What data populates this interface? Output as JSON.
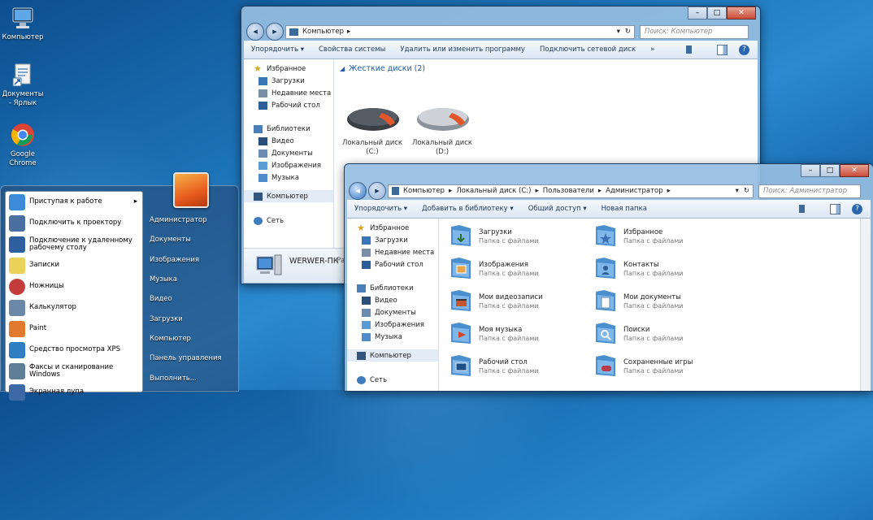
{
  "desktop_icons": [
    {
      "label": "Компьютер"
    },
    {
      "label": "Документы - Ярлык"
    },
    {
      "label": "Google Chrome"
    }
  ],
  "start_menu": {
    "left_items": [
      {
        "label": "Приступая к работе",
        "arrow": "▸",
        "color": "#3c8bd9"
      },
      {
        "label": "Подключить к проектору",
        "color": "#4a6fa0"
      },
      {
        "label": "Подключение к удаленному рабочему столу",
        "color": "#2e5e9e"
      },
      {
        "label": "Записки",
        "color": "#e9d15a"
      },
      {
        "label": "Ножницы",
        "color": "#c23c3c"
      },
      {
        "label": "Калькулятор",
        "color": "#6b88a8"
      },
      {
        "label": "Paint",
        "color": "#e07a2e"
      },
      {
        "label": "Средство просмотра XPS",
        "color": "#2f7ec4"
      },
      {
        "label": "Факсы и сканирование Windows",
        "color": "#5f7f99"
      },
      {
        "label": "Экранная лупа",
        "color": "#3d6aa7"
      }
    ],
    "right_items": [
      {
        "label": "Администратор"
      },
      {
        "label": "Документы"
      },
      {
        "label": "Изображения"
      },
      {
        "label": "Музыка"
      },
      {
        "label": "Видео"
      },
      {
        "label": "Загрузки"
      },
      {
        "label": "Компьютер"
      },
      {
        "label": "Панель управления"
      },
      {
        "label": "Выполнить..."
      }
    ]
  },
  "window1": {
    "caption_buttons": {
      "minimize": "–",
      "maximize": "□",
      "close": "✕"
    },
    "address": {
      "crumb": "Компьютер",
      "sep": "▸",
      "dropdown": "▾",
      "refresh": "↻"
    },
    "search_placeholder": "Поиск: Компьютер",
    "toolbar": {
      "organize": "Упорядочить ▾",
      "system_properties": "Свойства системы",
      "uninstall": "Удалить или изменить программу",
      "map_drive": "Подключить сетевой диск",
      "more": "»"
    },
    "nav": {
      "favorites": "Избранное",
      "downloads": "Загрузки",
      "recent": "Недавние места",
      "desktop": "Рабочий стол",
      "libraries": "Библиотеки",
      "video": "Видео",
      "documents": "Документы",
      "images": "Изображения",
      "music": "Музыка",
      "computer": "Компьютер",
      "network": "Сеть"
    },
    "group_header": "Жесткие диски (2)",
    "drives": [
      {
        "name": "Локальный диск",
        "letter": "(C:)"
      },
      {
        "name": "Локальный диск",
        "letter": "(D:)"
      }
    ],
    "details": {
      "pc_name": "WERWER-ПК",
      "extra": "Ра"
    }
  },
  "window2": {
    "caption_buttons": {
      "minimize": "–",
      "maximize": "□",
      "close": "✕"
    },
    "address": {
      "crumbs": [
        "Компьютер",
        "Локальный диск (C:)",
        "Пользователи",
        "Администратор"
      ],
      "sep": "▸",
      "dropdown": "▾",
      "refresh": "↻"
    },
    "search_placeholder": "Поиск: Администратор",
    "toolbar": {
      "organize": "Упорядочить ▾",
      "add_library": "Добавить в библиотеку ▾",
      "share": "Общий доступ ▾",
      "new_folder": "Новая папка"
    },
    "nav": {
      "favorites": "Избранное",
      "downloads": "Загрузки",
      "recent": "Недавние места",
      "desktop": "Рабочий стол",
      "libraries": "Библиотеки",
      "video": "Видео",
      "documents": "Документы",
      "images": "Изображения",
      "music": "Музыка",
      "computer": "Компьютер",
      "network": "Сеть"
    },
    "folders": [
      {
        "name": "Загрузки",
        "type": "Папка с файлами"
      },
      {
        "name": "Избранное",
        "type": "Папка с файлами"
      },
      {
        "name": "Изображения",
        "type": "Папка с файлами"
      },
      {
        "name": "Контакты",
        "type": "Папка с файлами"
      },
      {
        "name": "Мои видеозаписи",
        "type": "Папка с файлами"
      },
      {
        "name": "Мои документы",
        "type": "Папка с файлами"
      },
      {
        "name": "Моя музыка",
        "type": "Папка с файлами"
      },
      {
        "name": "Поиски",
        "type": "Папка с файлами"
      },
      {
        "name": "Рабочий стол",
        "type": "Папка с файлами"
      },
      {
        "name": "Сохраненные игры",
        "type": "Папка с файлами"
      }
    ]
  },
  "colors": {
    "accent": "#1e395b",
    "group_header": "#1e5aa6",
    "window_frame": "#96bee1"
  }
}
